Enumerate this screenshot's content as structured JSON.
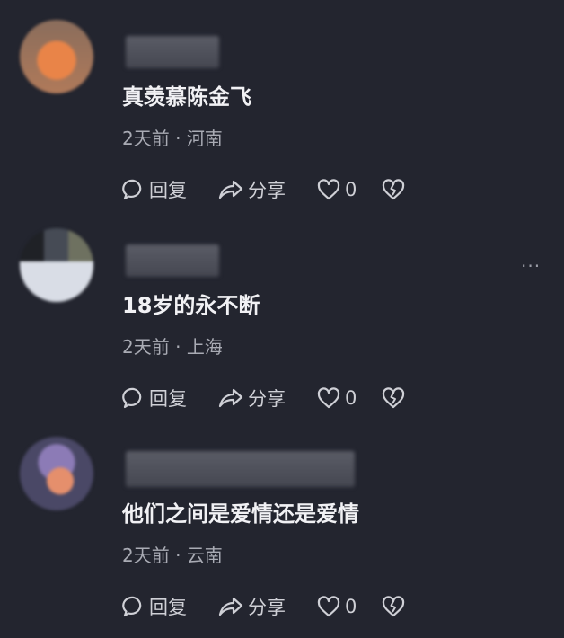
{
  "comments": [
    {
      "text": "真羡慕陈金飞",
      "time": "2天前",
      "location": "河南",
      "reply": "回复",
      "share": "分享",
      "likes": "0"
    },
    {
      "text": "18岁的永不断",
      "time": "2天前",
      "location": "上海",
      "reply": "回复",
      "share": "分享",
      "likes": "0",
      "more": "···"
    },
    {
      "text": "他们之间是爱情还是爱情",
      "time": "2天前",
      "location": "云南",
      "reply": "回复",
      "share": "分享",
      "likes": "0"
    }
  ],
  "separator": "·",
  "icons": [
    "comment-bubble-icon",
    "share-arrow-icon",
    "heart-icon",
    "broken-heart-icon",
    "more-dots-icon"
  ]
}
